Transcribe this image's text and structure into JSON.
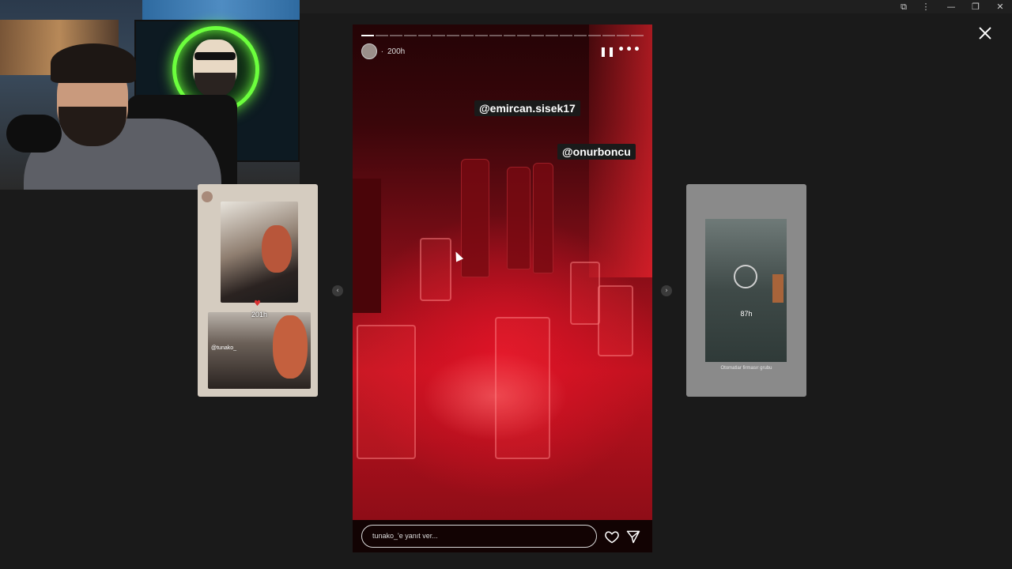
{
  "browser": {
    "controls": [
      "⧉",
      "⋮",
      "—",
      "❐",
      "✕"
    ]
  },
  "story": {
    "progress_segments": 20,
    "progress_done": 1,
    "age": "200h",
    "dot": ".",
    "mentions": [
      "@emircan.sisek17",
      "@onurboncu"
    ],
    "reply_placeholder": "tunako_'e yanıt ver...",
    "pause_icon": "pause-icon",
    "more_icon": "more-icon"
  },
  "left_thumb": {
    "time": "201h",
    "tag": "@tunako_",
    "heart": "♥"
  },
  "right_thumb": {
    "time": "87h",
    "caption": "Otomatlar firmasır grubu"
  },
  "nav": {
    "prev": "‹",
    "next": "›"
  },
  "colors": {
    "background": "#1a1a1a",
    "story_red": "#c0121f",
    "glow_green": "#6cff3d"
  }
}
